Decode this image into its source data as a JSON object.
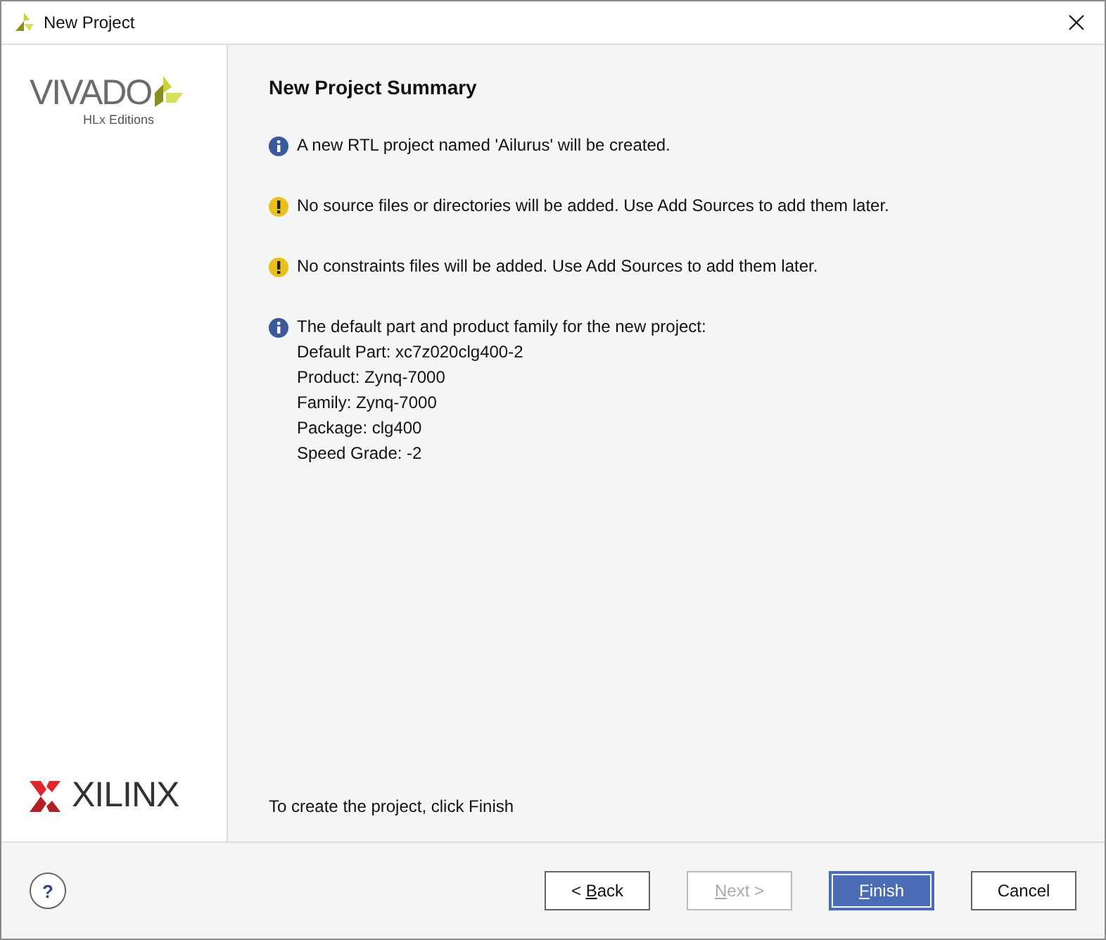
{
  "window": {
    "title": "New Project"
  },
  "sidebar": {
    "product": "VIVADO",
    "edition": "HLx Editions",
    "vendor": "XILINX"
  },
  "page": {
    "heading": "New Project Summary",
    "messages": [
      {
        "kind": "info",
        "text": "A new RTL project named 'Ailurus' will be created."
      },
      {
        "kind": "warning",
        "text": "No source files or directories will be added. Use Add Sources to add them later."
      },
      {
        "kind": "warning",
        "text": "No constraints files will be added. Use Add Sources to add them later."
      },
      {
        "kind": "info",
        "text": "The default part and product family for the new project:",
        "details": [
          "Default Part: xc7z020clg400-2",
          "Product: Zynq-7000",
          "Family: Zynq-7000",
          "Package: clg400",
          "Speed Grade: -2"
        ]
      }
    ],
    "footer_note": "To create the project, click Finish"
  },
  "help_button": {
    "label": "?"
  },
  "buttons": [
    {
      "kind": "normal",
      "before": "< ",
      "key": "B",
      "after": "ack",
      "disabled": false
    },
    {
      "kind": "normal",
      "key": "N",
      "after": "ext >",
      "disabled": true
    },
    {
      "kind": "primary",
      "key": "F",
      "after": "inish",
      "disabled": false
    },
    {
      "kind": "normal",
      "before": "Cancel",
      "disabled": false
    }
  ]
}
